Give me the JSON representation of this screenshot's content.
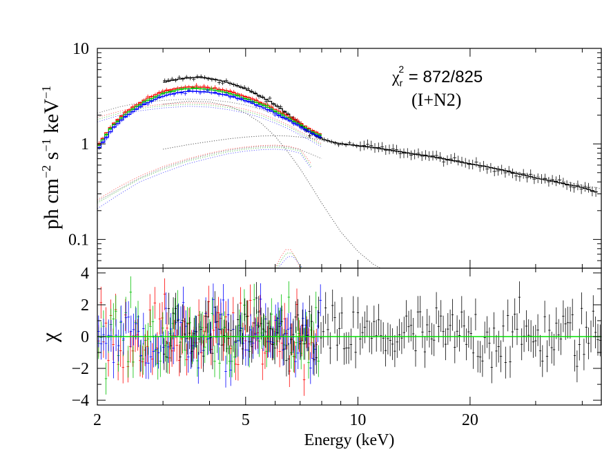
{
  "chart_data": [
    {
      "type": "line",
      "panel": "spectrum",
      "ylabel_parts": {
        "base": "ph cm",
        "exp1": "−2",
        "mid": " s",
        "exp2": "−1",
        "tail": " keV",
        "exp3": "−1"
      },
      "xscale": "log",
      "yscale": "log",
      "xlim": [
        2,
        45
      ],
      "ylim": [
        0.05,
        10
      ],
      "yticks": [
        {
          "value": 10,
          "label": "10"
        },
        {
          "value": 1,
          "label": "1"
        },
        {
          "value": 0.1,
          "label": "0.1"
        }
      ],
      "annotation": {
        "chi_symbol": "χ",
        "chi_sub": "r",
        "chi_sup": "2",
        "chi_value": " = 872/825",
        "model": "(I+N2)"
      },
      "series": [
        {
          "color": "#000000",
          "kind": "data",
          "x": [
            3.0,
            3.2,
            3.4,
            3.6,
            3.8,
            4.0,
            4.3,
            4.6,
            5.0,
            5.4,
            5.8,
            6.2,
            6.6,
            7.0,
            7.5,
            8.0,
            8.5,
            9.0,
            10,
            11,
            12,
            13,
            14,
            15,
            16,
            17,
            18,
            19,
            20,
            22,
            24,
            26,
            28,
            30,
            33,
            36,
            40,
            44
          ],
          "y": [
            4.4,
            4.65,
            4.85,
            4.95,
            4.95,
            4.85,
            4.6,
            4.25,
            3.75,
            3.25,
            2.8,
            2.35,
            1.95,
            1.6,
            1.3,
            1.13,
            1.05,
            1.0,
            0.96,
            0.92,
            0.87,
            0.83,
            0.79,
            0.76,
            0.73,
            0.7,
            0.67,
            0.64,
            0.62,
            0.58,
            0.54,
            0.5,
            0.47,
            0.44,
            0.41,
            0.38,
            0.35,
            0.31
          ]
        },
        {
          "color": "#ff0000",
          "kind": "data",
          "x": [
            2.0,
            2.1,
            2.2,
            2.35,
            2.5,
            2.7,
            2.9,
            3.1,
            3.3,
            3.5,
            3.7,
            3.9,
            4.2,
            4.5,
            4.8,
            5.1,
            5.5,
            6.0,
            6.5,
            7.0,
            7.5,
            8.0
          ],
          "y": [
            0.92,
            1.25,
            1.6,
            2.05,
            2.45,
            2.95,
            3.35,
            3.65,
            3.85,
            3.95,
            3.95,
            3.9,
            3.75,
            3.55,
            3.3,
            3.05,
            2.7,
            2.3,
            1.95,
            1.65,
            1.4,
            1.25
          ]
        },
        {
          "color": "#00c000",
          "kind": "data",
          "x": [
            2.0,
            2.1,
            2.2,
            2.35,
            2.5,
            2.7,
            2.9,
            3.1,
            3.3,
            3.5,
            3.7,
            3.9,
            4.2,
            4.5,
            4.8,
            5.1,
            5.5,
            6.0,
            6.5,
            7.0,
            7.5,
            8.0
          ],
          "y": [
            0.9,
            1.2,
            1.55,
            1.95,
            2.35,
            2.8,
            3.2,
            3.5,
            3.7,
            3.8,
            3.8,
            3.75,
            3.6,
            3.4,
            3.15,
            2.9,
            2.6,
            2.2,
            1.85,
            1.58,
            1.35,
            1.2
          ]
        },
        {
          "color": "#0000ff",
          "kind": "data",
          "x": [
            2.0,
            2.1,
            2.2,
            2.35,
            2.5,
            2.7,
            2.9,
            3.1,
            3.3,
            3.5,
            3.7,
            3.9,
            4.2,
            4.5,
            4.8,
            5.1,
            5.5,
            6.0,
            6.5,
            7.0,
            7.5,
            8.0
          ],
          "y": [
            0.86,
            1.12,
            1.45,
            1.85,
            2.2,
            2.65,
            3.0,
            3.28,
            3.45,
            3.55,
            3.55,
            3.5,
            3.38,
            3.2,
            2.98,
            2.75,
            2.45,
            2.1,
            1.78,
            1.52,
            1.3,
            1.15
          ]
        },
        {
          "color": "#777777",
          "kind": "model",
          "x": [
            2.0,
            2.3,
            2.6,
            3.0,
            3.5,
            4.0,
            4.5,
            5.0,
            5.5,
            6.0,
            6.5,
            7.0,
            7.5,
            8.0
          ],
          "y": [
            2.1,
            2.45,
            2.7,
            2.85,
            2.95,
            2.9,
            2.75,
            2.55,
            2.3,
            2.0,
            1.75,
            1.5,
            1.28,
            1.1
          ]
        },
        {
          "color": "#ff6666",
          "kind": "model",
          "x": [
            2.0,
            2.3,
            2.6,
            3.0,
            3.5,
            4.0,
            4.5,
            5.0,
            5.5,
            6.0,
            6.5,
            7.0,
            7.5,
            8.0
          ],
          "y": [
            1.9,
            2.2,
            2.45,
            2.6,
            2.7,
            2.65,
            2.5,
            2.3,
            2.07,
            1.82,
            1.58,
            1.35,
            1.16,
            1.0
          ]
        },
        {
          "color": "#66cc66",
          "kind": "model",
          "x": [
            2.0,
            2.3,
            2.6,
            3.0,
            3.5,
            4.0,
            4.5,
            5.0,
            5.5,
            6.0,
            6.5,
            7.0,
            7.5,
            8.0
          ],
          "y": [
            1.8,
            2.1,
            2.35,
            2.5,
            2.6,
            2.55,
            2.4,
            2.2,
            1.98,
            1.74,
            1.52,
            1.3,
            1.12,
            0.97
          ]
        },
        {
          "color": "#6666ff",
          "kind": "model",
          "x": [
            2.0,
            2.3,
            2.6,
            3.0,
            3.5,
            4.0,
            4.5,
            5.0,
            5.5,
            6.0,
            6.5,
            7.0,
            7.5,
            8.0
          ],
          "y": [
            1.7,
            2.0,
            2.22,
            2.38,
            2.48,
            2.43,
            2.28,
            2.1,
            1.88,
            1.65,
            1.44,
            1.24,
            1.07,
            0.93
          ]
        },
        {
          "color": "#555555",
          "kind": "model",
          "x": [
            3.0,
            3.5,
            4.0,
            4.5,
            5.0,
            5.5,
            6.0,
            6.5,
            7.0,
            7.5,
            8.0,
            9.0,
            10,
            12,
            15,
            20,
            25,
            30,
            35,
            40,
            45
          ],
          "y": [
            0.88,
            0.98,
            1.06,
            1.13,
            1.18,
            1.21,
            1.22,
            1.21,
            1.18,
            1.14,
            1.1,
            1.02,
            0.95,
            0.85,
            0.74,
            0.62,
            0.53,
            0.46,
            0.41,
            0.37,
            0.34
          ]
        },
        {
          "color": "#555555",
          "kind": "model",
          "x": [
            3.0,
            3.5,
            4.0,
            4.5,
            5.0,
            5.5,
            6.0,
            6.5,
            7.0,
            7.5,
            8.0,
            9.0,
            10,
            11,
            11.5
          ],
          "y": [
            2.6,
            2.8,
            2.75,
            2.5,
            2.1,
            1.65,
            1.2,
            0.82,
            0.55,
            0.36,
            0.24,
            0.12,
            0.075,
            0.055,
            0.05
          ]
        },
        {
          "color": "#ff6666",
          "kind": "model",
          "x": [
            2.0,
            2.3,
            2.6,
            3.0,
            3.5,
            4.0,
            4.5,
            5.0,
            5.5,
            6.0,
            6.5,
            7.0,
            7.5
          ],
          "y": [
            0.26,
            0.36,
            0.46,
            0.58,
            0.7,
            0.8,
            0.88,
            0.93,
            0.96,
            0.97,
            0.95,
            0.88,
            0.62
          ]
        },
        {
          "color": "#66cc66",
          "kind": "model",
          "x": [
            2.0,
            2.3,
            2.6,
            3.0,
            3.5,
            4.0,
            4.5,
            5.0,
            5.5,
            6.0,
            6.5,
            7.0,
            7.5
          ],
          "y": [
            0.24,
            0.33,
            0.43,
            0.54,
            0.66,
            0.75,
            0.83,
            0.88,
            0.91,
            0.92,
            0.9,
            0.84,
            0.58
          ]
        },
        {
          "color": "#6666ff",
          "kind": "model",
          "x": [
            2.0,
            2.3,
            2.6,
            3.0,
            3.5,
            4.0,
            4.5,
            5.0,
            5.5,
            6.0,
            6.5,
            7.0,
            7.5
          ],
          "y": [
            0.21,
            0.3,
            0.4,
            0.5,
            0.62,
            0.71,
            0.79,
            0.84,
            0.87,
            0.88,
            0.86,
            0.8,
            0.55
          ]
        },
        {
          "color": "#777777",
          "kind": "model",
          "x": [
            2.0,
            2.3,
            2.6,
            3.0,
            3.5,
            4.0,
            4.5,
            5.0,
            5.5,
            6.0,
            6.5,
            7.0,
            7.5,
            8.0
          ],
          "y": [
            0.25,
            0.34,
            0.44,
            0.56,
            0.68,
            0.78,
            0.86,
            0.91,
            0.94,
            0.95,
            0.93,
            0.87,
            0.78,
            0.7
          ]
        },
        {
          "color": "#ff6666",
          "kind": "model",
          "x": [
            6.0,
            6.2,
            6.4,
            6.6,
            6.8,
            7.0
          ],
          "y": [
            0.05,
            0.065,
            0.078,
            0.078,
            0.065,
            0.05
          ]
        },
        {
          "color": "#66cc66",
          "kind": "model",
          "x": [
            6.05,
            6.25,
            6.45,
            6.65,
            6.85,
            7.05
          ],
          "y": [
            0.05,
            0.062,
            0.072,
            0.072,
            0.062,
            0.05
          ]
        },
        {
          "color": "#6666ff",
          "kind": "model",
          "x": [
            6.1,
            6.3,
            6.5,
            6.7,
            6.9,
            7.1
          ],
          "y": [
            0.05,
            0.058,
            0.066,
            0.066,
            0.058,
            0.05
          ]
        }
      ]
    },
    {
      "type": "scatter",
      "panel": "residuals",
      "ylabel": "χ",
      "xlabel": "Energy (keV)",
      "xscale": "log",
      "xlim": [
        2,
        45
      ],
      "ylim": [
        -4.3,
        4.3
      ],
      "yticks": [
        {
          "value": 4,
          "label": "4"
        },
        {
          "value": 2,
          "label": "2"
        },
        {
          "value": 0,
          "label": "0"
        },
        {
          "value": -2,
          "label": "−2"
        },
        {
          "value": -4,
          "label": "−4"
        }
      ],
      "xticks": [
        {
          "value": 2,
          "label": "2"
        },
        {
          "value": 5,
          "label": "5"
        },
        {
          "value": 10,
          "label": "10"
        },
        {
          "value": 20,
          "label": "20"
        }
      ],
      "zero_line_color": "#00e000",
      "series": [
        {
          "color": "#ff0000",
          "x_range": [
            2.0,
            7.8
          ],
          "count": 90,
          "spread": 1.1
        },
        {
          "color": "#00c000",
          "x_range": [
            2.0,
            7.9
          ],
          "count": 90,
          "spread": 1.1
        },
        {
          "color": "#0000ff",
          "x_range": [
            2.0,
            8.0
          ],
          "count": 90,
          "spread": 1.1
        },
        {
          "color": "#000000",
          "x_range": [
            3.0,
            45.0
          ],
          "count": 190,
          "spread": 1.0
        }
      ]
    }
  ]
}
